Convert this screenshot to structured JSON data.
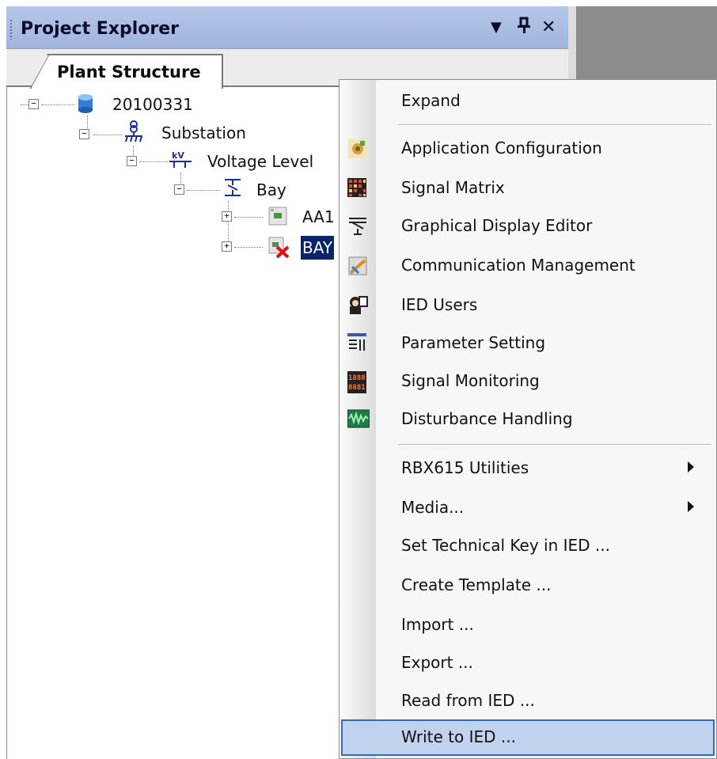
{
  "panel": {
    "title": "Project Explorer",
    "buttons": {
      "dropdown": "▼",
      "pin": "ᵽ",
      "close": "✕"
    },
    "tab": "Plant Structure"
  },
  "tree": [
    {
      "label": "20100331",
      "icon": "database-icon",
      "expander": "−"
    },
    {
      "label": "Substation",
      "icon": "substation-icon",
      "expander": "−"
    },
    {
      "label": "Voltage Level",
      "icon": "voltage-level-icon",
      "expander": "−"
    },
    {
      "label": "Bay",
      "icon": "bay-icon",
      "expander": "−"
    },
    {
      "label": "AA1",
      "icon": "ied-icon",
      "expander": "+"
    },
    {
      "label": "BAY",
      "icon": "ied-error-icon",
      "expander": "+",
      "selected": true
    }
  ],
  "menu": {
    "items": [
      {
        "label": "Expand"
      },
      {
        "label": "Application Configuration",
        "icon": "application-configuration-icon"
      },
      {
        "label": "Signal Matrix",
        "icon": "signal-matrix-icon"
      },
      {
        "label": "Graphical Display Editor",
        "icon": "graphical-display-editor-icon"
      },
      {
        "label": "Communication Management",
        "icon": "communication-management-icon"
      },
      {
        "label": "IED Users",
        "icon": "ied-users-icon"
      },
      {
        "label": "Parameter Setting",
        "icon": "parameter-setting-icon"
      },
      {
        "label": "Signal Monitoring",
        "icon": "signal-monitoring-icon"
      },
      {
        "label": "Disturbance Handling",
        "icon": "disturbance-handling-icon"
      },
      {
        "label": "RBX615 Utilities",
        "submenu": true
      },
      {
        "label": "Media...",
        "submenu": true
      },
      {
        "label": "Set Technical Key in IED ..."
      },
      {
        "label": "Create Template ..."
      },
      {
        "label": "Import ..."
      },
      {
        "label": "Export ..."
      },
      {
        "label": "Read from IED ..."
      },
      {
        "label": "Write to IED ...",
        "highlighted": true
      }
    ]
  },
  "colors": {
    "title_bar": "#b5c7e8",
    "selection": "#0a246a",
    "menu_highlight": "#c1d2ee"
  }
}
